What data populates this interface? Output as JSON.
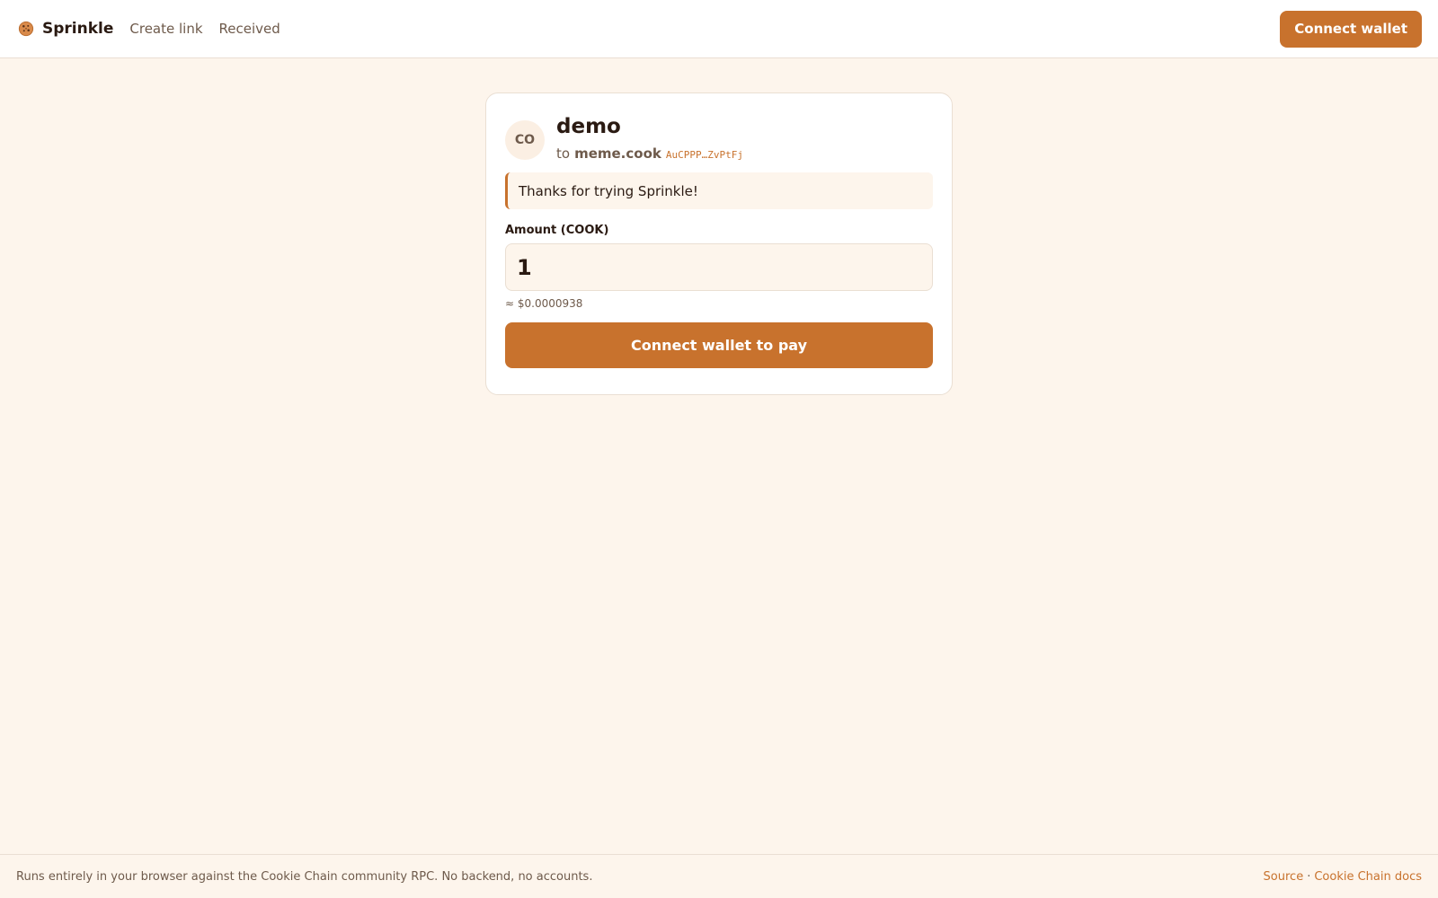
{
  "header": {
    "brand": "Sprinkle",
    "nav": [
      {
        "label": "Create link"
      },
      {
        "label": "Received"
      }
    ],
    "connect_label": "Connect wallet"
  },
  "card": {
    "avatar_initials": "CO",
    "title": "demo",
    "recipient_prefix": "to",
    "recipient_name": "meme.cook",
    "recipient_address": "AuCPPP…ZvPtFj",
    "message": "Thanks for trying Sprinkle!",
    "amount_label": "Amount (COOK)",
    "amount_value": "1",
    "fiat_estimate": "≈ $0.0000938",
    "pay_label": "Connect wallet to pay"
  },
  "footer": {
    "note": "Runs entirely in your browser against the Cookie Chain community RPC. No backend, no accounts.",
    "links": [
      {
        "label": "Source"
      },
      {
        "label": "Cookie Chain docs"
      }
    ],
    "separator": "·"
  },
  "colors": {
    "accent": "#c8722d",
    "background": "#fdf5ec",
    "surface": "#ffffff",
    "border": "#eadfd3",
    "text": "#2a1a12",
    "muted": "#6e5a4b"
  },
  "icons": {
    "brand_logo": "cookie-icon"
  }
}
